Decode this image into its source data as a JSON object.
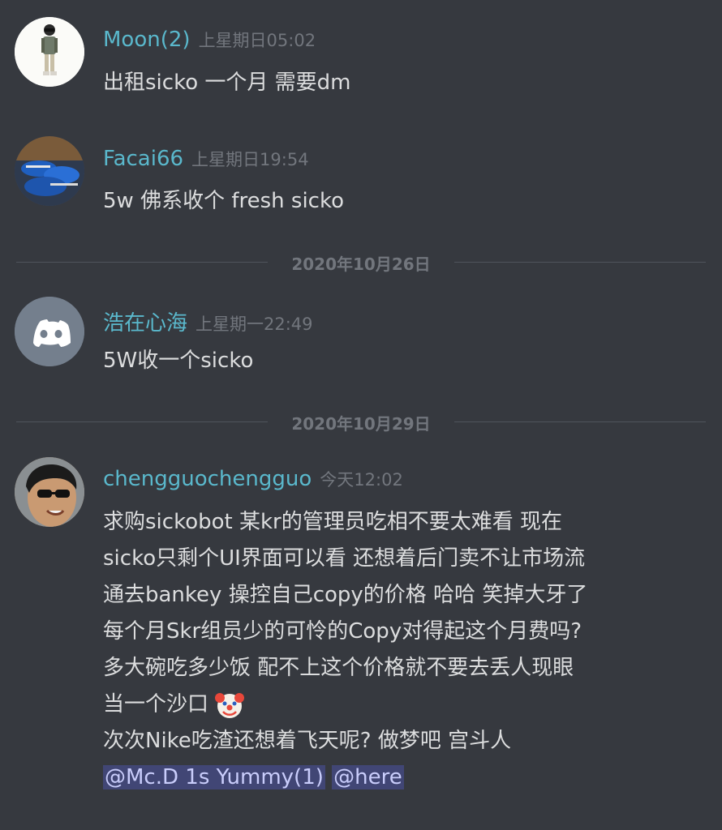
{
  "messages": [
    {
      "user": "Moon(2)",
      "time": "上星期日05:02",
      "lines": [
        "出租sicko 一个月 需要dm"
      ]
    },
    {
      "user": "Facai66",
      "time": "上星期日19:54",
      "lines": [
        "5w 佛系收个 fresh sicko"
      ]
    },
    {
      "user": "浩在心海",
      "time": "上星期一22:49",
      "lines": [
        "5W收一个sicko"
      ]
    },
    {
      "user": "chengguochengguo",
      "time": "今天12:02",
      "lines": [
        "求购sickobot  某kr的管理员吃相不要太难看 现在",
        "sicko只剩个UI界面可以看 还想着后门卖不让市场流",
        "通去bankey 操控自己copy的价格 哈哈 笑掉大牙了",
        "每个月Skr组员少的可怜的Copy对得起这个月费吗?",
        "多大碗吃多少饭 配不上这个价格就不要去丢人现眼",
        "当一个沙口",
        "次次Nike吃渣还想着飞天呢?  做梦吧 宫斗人"
      ],
      "mentions": [
        "@Mc.D 1s Yummy(1)",
        "@here"
      ]
    }
  ],
  "dividers": [
    "2020年10月26日",
    "2020年10月29日"
  ],
  "colors": {
    "background": "#36393f",
    "username": "#5ab8cc",
    "timestamp": "#72767d",
    "text": "#dcddde",
    "mention_bg": "#414675",
    "mention_text": "#c9cdfb"
  },
  "icons": {
    "discord_default_avatar": "discord-logo-icon",
    "clown_emoji": "clown-face-emoji"
  }
}
